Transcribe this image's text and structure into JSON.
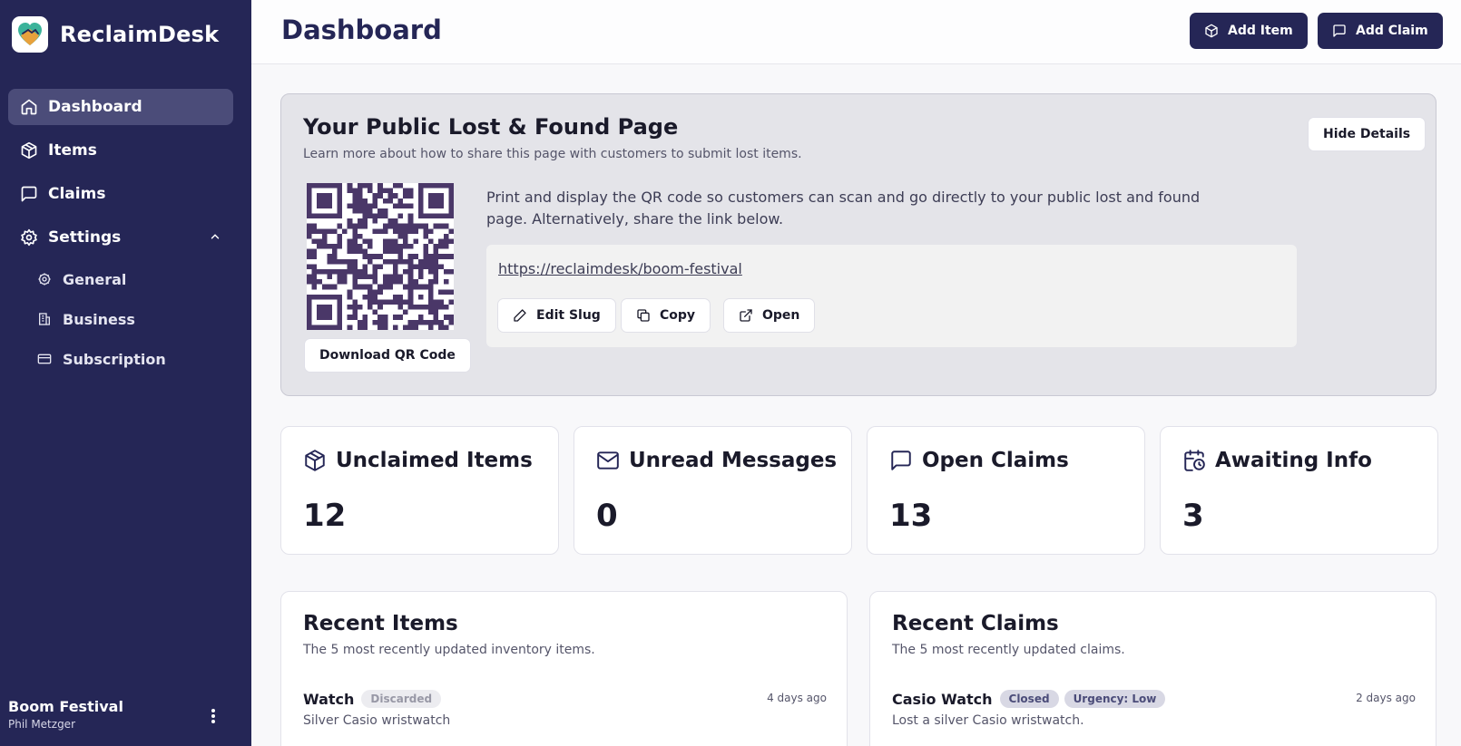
{
  "app": {
    "name": "ReclaimDesk"
  },
  "sidebar": {
    "items": [
      {
        "label": "Dashboard",
        "icon": "home-icon",
        "active": true
      },
      {
        "label": "Items",
        "icon": "package-icon"
      },
      {
        "label": "Claims",
        "icon": "message-square-icon"
      },
      {
        "label": "Settings",
        "icon": "gear-icon",
        "expanded": true
      }
    ],
    "settings_items": [
      {
        "label": "General",
        "icon": "cog-icon"
      },
      {
        "label": "Business",
        "icon": "building-icon"
      },
      {
        "label": "Subscription",
        "icon": "credit-card-icon"
      }
    ],
    "account": {
      "org": "Boom Festival",
      "user": "Phil Metzger"
    }
  },
  "header": {
    "title": "Dashboard",
    "add_item": "Add Item",
    "add_claim": "Add Claim"
  },
  "public_page": {
    "title": "Your Public Lost & Found Page",
    "subtitle": "Learn more about how to share this page with customers to submit lost items.",
    "hide_details": "Hide Details",
    "description": "Print and display the QR code so customers can scan and go directly to your public lost and found page. Alternatively, share the link below.",
    "url": "https://reclaimdesk/boom-festival",
    "edit_slug": "Edit Slug",
    "copy": "Copy",
    "open": "Open",
    "download_qr": "Download QR Code"
  },
  "stats": [
    {
      "label": "Unclaimed Items",
      "value": "12",
      "icon": "package-icon"
    },
    {
      "label": "Unread Messages",
      "value": "0",
      "icon": "mail-icon"
    },
    {
      "label": "Open Claims",
      "value": "13",
      "icon": "message-square-icon"
    },
    {
      "label": "Awaiting Info",
      "value": "3",
      "icon": "calendar-clock-icon"
    }
  ],
  "recent_items": {
    "title": "Recent Items",
    "subtitle": "The 5 most recently updated inventory items.",
    "rows": [
      {
        "name": "Watch",
        "badges": [
          "Discarded"
        ],
        "desc": "Silver Casio wristwatch",
        "time": "4 days ago"
      }
    ]
  },
  "recent_claims": {
    "title": "Recent Claims",
    "subtitle": "The 5 most recently updated claims.",
    "rows": [
      {
        "name": "Casio Watch",
        "badges": [
          "Closed",
          "Urgency: Low"
        ],
        "desc": "Lost a silver Casio wristwatch.",
        "time": "2 days ago"
      }
    ]
  },
  "colors": {
    "sidebar": "#252656",
    "active": "#4b4c79",
    "qr": "#4a3768"
  }
}
